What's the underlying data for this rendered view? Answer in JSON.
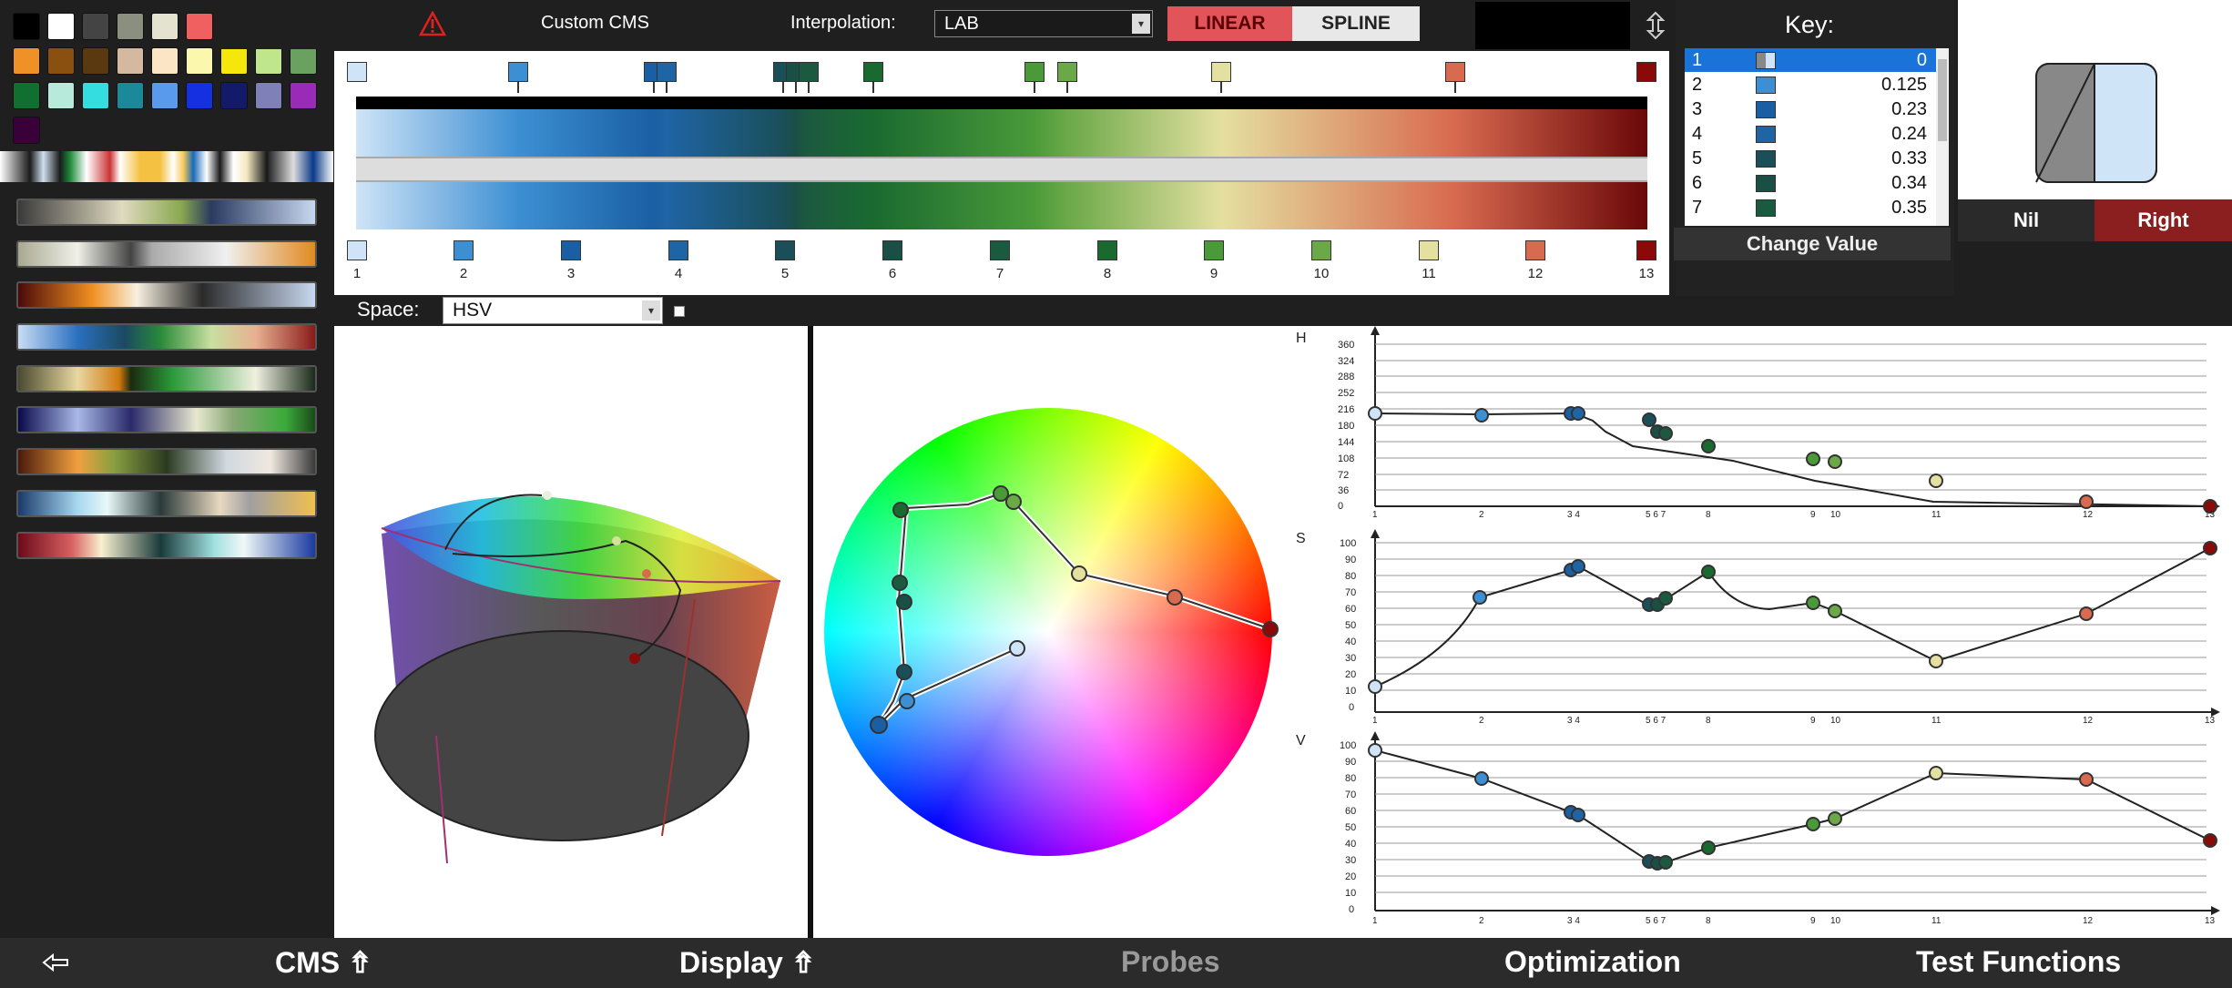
{
  "toolbar": {
    "warning_icon": "warning-triangle-icon",
    "title": "Custom CMS",
    "interpolation_label": "Interpolation:",
    "interpolation_value": "LAB",
    "linear_label": "LINEAR",
    "spline_label": "SPLINE",
    "resize_icon": "vertical-resize-icon"
  },
  "editor": {
    "marker_numbers": [
      "1",
      "2",
      "3",
      "4",
      "5",
      "6",
      "7",
      "8",
      "9",
      "10",
      "11",
      "12",
      "13"
    ]
  },
  "space": {
    "label": "Space:",
    "value": "HSV"
  },
  "key": {
    "title": "Key:",
    "rows": [
      {
        "index": "1",
        "value": "0",
        "color": "#cfe4f7"
      },
      {
        "index": "2",
        "value": "0.125",
        "color": "#3d8fd3"
      },
      {
        "index": "3",
        "value": "0.23",
        "color": "#1a5fa3"
      },
      {
        "index": "4",
        "value": "0.24",
        "color": "#1f64a5"
      },
      {
        "index": "5",
        "value": "0.33",
        "color": "#1a4f5a"
      },
      {
        "index": "6",
        "value": "0.34",
        "color": "#1a4f46"
      },
      {
        "index": "7",
        "value": "0.35",
        "color": "#1c5a40"
      }
    ],
    "change_value_label": "Change Value"
  },
  "side": {
    "nil_label": "Nil",
    "right_label": "Right"
  },
  "plots": {
    "h_label": "H",
    "s_label": "S",
    "v_label": "V",
    "h_ticks": [
      "360",
      "324",
      "288",
      "252",
      "216",
      "180",
      "144",
      "108",
      "72",
      "36",
      "0"
    ],
    "sv_ticks": [
      "100",
      "90",
      "80",
      "70",
      "60",
      "50",
      "40",
      "30",
      "20",
      "10",
      "0"
    ],
    "x_ticks": [
      "1",
      "2",
      "3 4",
      "5 6 7",
      "8",
      "9",
      "10",
      "11",
      "12",
      "13"
    ]
  },
  "bottom": {
    "back_icon": "back-arrow-icon",
    "cms_label": "CMS ⇮",
    "display_label": "Display ⇮",
    "probes_label": "Probes",
    "optimization_label": "Optimization",
    "test_functions_label": "Test Functions"
  },
  "colors": {
    "accent_red": "#e0545a",
    "right_button": "#8b1f1f"
  }
}
